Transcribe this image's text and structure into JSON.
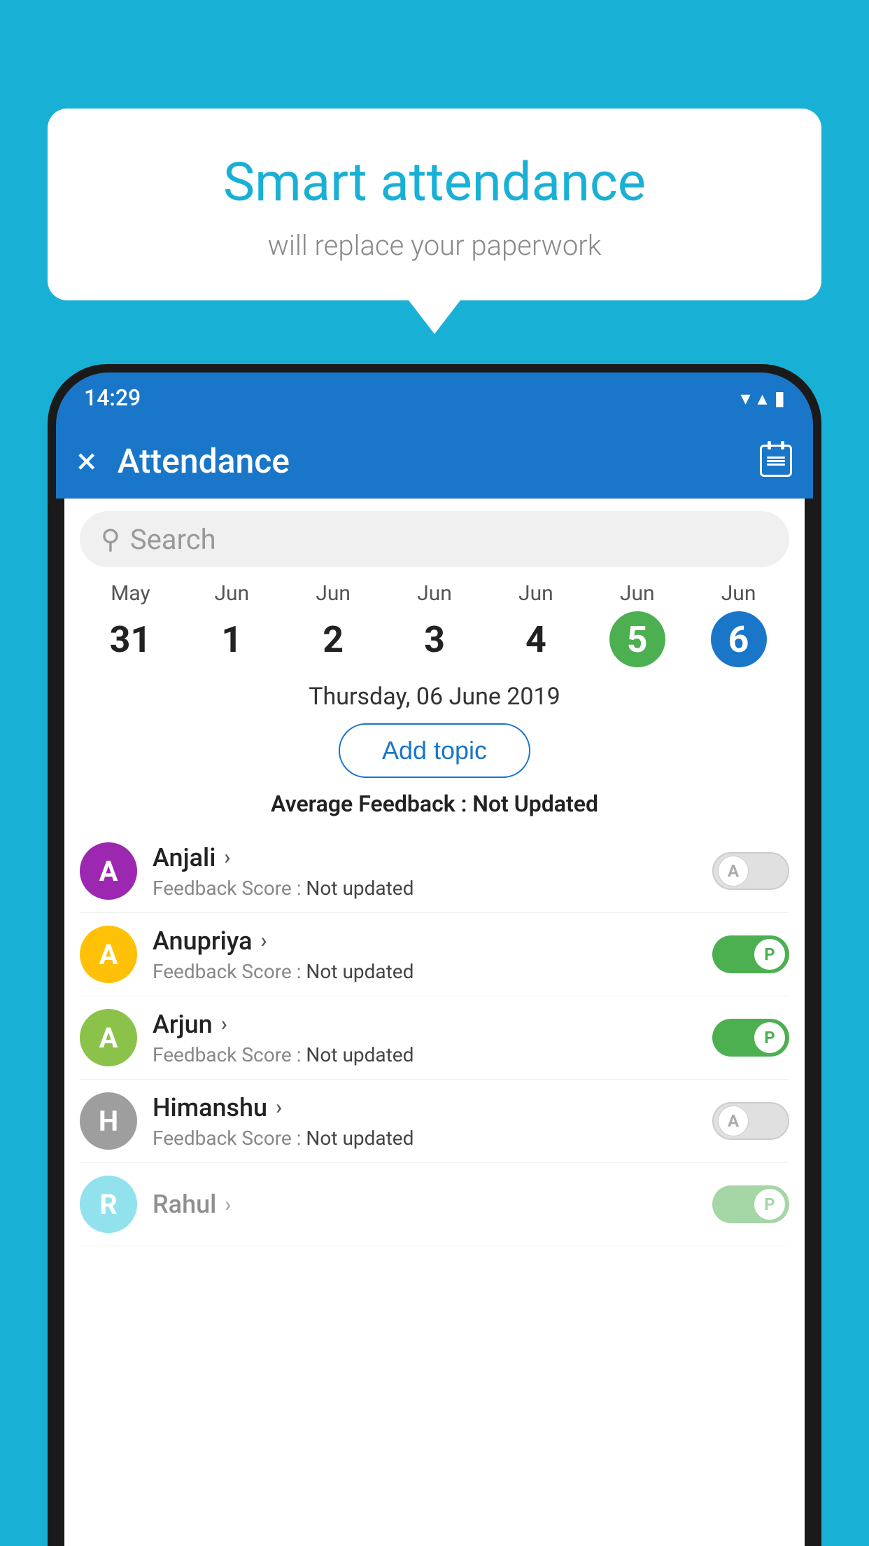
{
  "background_color": "#19b0d6",
  "speech_bubble": {
    "title": "Smart attendance",
    "subtitle": "will replace your paperwork"
  },
  "status_bar": {
    "time": "14:29",
    "icons": [
      "wifi",
      "signal",
      "battery"
    ]
  },
  "app_bar": {
    "title": "Attendance",
    "close_label": "×",
    "close_icon": "close-icon",
    "calendar_icon": "calendar-icon"
  },
  "search": {
    "placeholder": "Search"
  },
  "dates": [
    {
      "month": "May",
      "day": "31",
      "state": "normal"
    },
    {
      "month": "Jun",
      "day": "1",
      "state": "normal"
    },
    {
      "month": "Jun",
      "day": "2",
      "state": "normal"
    },
    {
      "month": "Jun",
      "day": "3",
      "state": "normal"
    },
    {
      "month": "Jun",
      "day": "4",
      "state": "normal"
    },
    {
      "month": "Jun",
      "day": "5",
      "state": "today"
    },
    {
      "month": "Jun",
      "day": "6",
      "state": "selected"
    }
  ],
  "selected_date_label": "Thursday, 06 June 2019",
  "add_topic_label": "Add topic",
  "avg_feedback_label": "Average Feedback :",
  "avg_feedback_value": "Not Updated",
  "students": [
    {
      "name": "Anjali",
      "avatar_letter": "A",
      "avatar_color": "#9c27b0",
      "feedback_label": "Feedback Score :",
      "feedback_value": "Not updated",
      "toggle_state": "off",
      "toggle_letter": "A"
    },
    {
      "name": "Anupriya",
      "avatar_letter": "A",
      "avatar_color": "#ffc107",
      "feedback_label": "Feedback Score :",
      "feedback_value": "Not updated",
      "toggle_state": "on",
      "toggle_letter": "P"
    },
    {
      "name": "Arjun",
      "avatar_letter": "A",
      "avatar_color": "#8bc34a",
      "feedback_label": "Feedback Score :",
      "feedback_value": "Not updated",
      "toggle_state": "on",
      "toggle_letter": "P"
    },
    {
      "name": "Himanshu",
      "avatar_letter": "H",
      "avatar_color": "#9e9e9e",
      "feedback_label": "Feedback Score :",
      "feedback_value": "Not updated",
      "toggle_state": "off",
      "toggle_letter": "A"
    }
  ]
}
